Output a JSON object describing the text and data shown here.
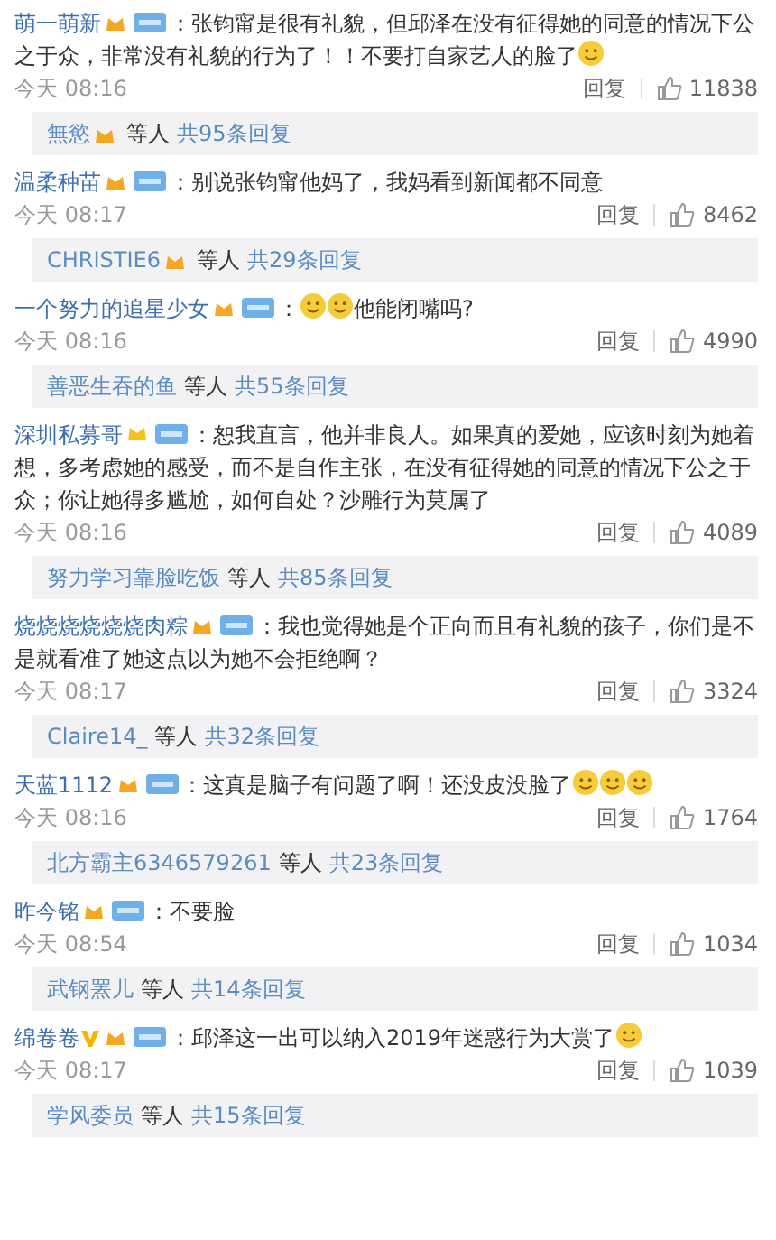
{
  "comments": [
    {
      "user": "萌一萌新",
      "badges": [
        {
          "kind": "vip"
        },
        {
          "kind": "fan"
        }
      ],
      "parts": [
        {
          "kind": "text",
          "text": "：张钧甯是很有礼貌，但邱泽在没有征得她的同意的情况下公之于众，非常没有礼貌的行为了！！不要打自家艺人的脸了"
        },
        {
          "kind": "emoji"
        }
      ],
      "time": "今天 08:16",
      "reply": "回复",
      "likes": "11838",
      "thread": {
        "user": "無慾",
        "user_badge": true,
        "middle": "等人",
        "count": "共95条回复"
      }
    },
    {
      "user": "温柔种苗",
      "badges": [
        {
          "kind": "vip"
        },
        {
          "kind": "fan"
        }
      ],
      "parts": [
        {
          "kind": "text",
          "text": "：别说张钧甯他妈了，我妈看到新闻都不同意"
        }
      ],
      "time": "今天 08:17",
      "reply": "回复",
      "likes": "8462",
      "thread": {
        "user": "CHRISTIE6",
        "user_badge": true,
        "middle": "等人",
        "count": "共29条回复"
      }
    },
    {
      "user": "一个努力的追星少女",
      "badges": [
        {
          "kind": "vip"
        },
        {
          "kind": "fan"
        }
      ],
      "parts": [
        {
          "kind": "text",
          "text": "："
        },
        {
          "kind": "emoji"
        },
        {
          "kind": "emoji"
        },
        {
          "kind": "text",
          "text": "他能闭嘴吗?"
        }
      ],
      "time": "今天 08:16",
      "reply": "回复",
      "likes": "4990",
      "thread": {
        "user": "善恶生吞的鱼",
        "user_badge": false,
        "middle": "等人",
        "count": "共55条回复"
      }
    },
    {
      "user": "深圳私募哥",
      "badges": [
        {
          "kind": "crown"
        },
        {
          "kind": "fan"
        }
      ],
      "parts": [
        {
          "kind": "text",
          "text": "：恕我直言，他并非良人。如果真的爱她，应该时刻为她着想，多考虑她的感受，而不是自作主张，在没有征得她的同意的情况下公之于众；你让她得多尴尬，如何自处？沙雕行为莫属了"
        }
      ],
      "time": "今天 08:16",
      "reply": "回复",
      "likes": "4089",
      "thread": {
        "user": "努力学习靠脸吃饭",
        "user_badge": false,
        "middle": "等人",
        "count": "共85条回复"
      }
    },
    {
      "user": "烧烧烧烧烧烧肉粽",
      "badges": [
        {
          "kind": "vip"
        },
        {
          "kind": "fan"
        }
      ],
      "parts": [
        {
          "kind": "text",
          "text": "：我也觉得她是个正向而且有礼貌的孩子，你们是不是就看准了她这点以为她不会拒绝啊？"
        }
      ],
      "time": "今天 08:17",
      "reply": "回复",
      "likes": "3324",
      "thread": {
        "user": "Claire14_",
        "user_badge": false,
        "middle": "等人",
        "count": "共32条回复"
      }
    },
    {
      "user": "天蓝1112",
      "badges": [
        {
          "kind": "vip"
        },
        {
          "kind": "fan"
        }
      ],
      "parts": [
        {
          "kind": "text",
          "text": "：这真是脑子有问题了啊！还没皮没脸了"
        },
        {
          "kind": "emoji"
        },
        {
          "kind": "emoji"
        },
        {
          "kind": "emoji"
        }
      ],
      "time": "今天 08:16",
      "reply": "回复",
      "likes": "1764",
      "thread": {
        "user": "北方霸主6346579261",
        "user_badge": false,
        "middle": "等人",
        "count": "共23条回复"
      }
    },
    {
      "user": "昨今铭",
      "badges": [
        {
          "kind": "vip"
        },
        {
          "kind": "fan"
        }
      ],
      "parts": [
        {
          "kind": "text",
          "text": "：不要脸"
        }
      ],
      "time": "今天 08:54",
      "reply": "回复",
      "likes": "1034",
      "thread": {
        "user": "武钢罴儿",
        "user_badge": false,
        "middle": "等人",
        "count": "共14条回复"
      }
    },
    {
      "user": "绵卷卷",
      "badges": [
        {
          "kind": "verified"
        },
        {
          "kind": "vip"
        },
        {
          "kind": "fan"
        }
      ],
      "parts": [
        {
          "kind": "text",
          "text": "：邱泽这一出可以纳入2019年迷惑行为大赏了"
        },
        {
          "kind": "emoji"
        }
      ],
      "time": "今天 08:17",
      "reply": "回复",
      "likes": "1039",
      "thread": {
        "user": "学风委员",
        "user_badge": false,
        "middle": "等人",
        "count": "共15条回复"
      }
    }
  ]
}
